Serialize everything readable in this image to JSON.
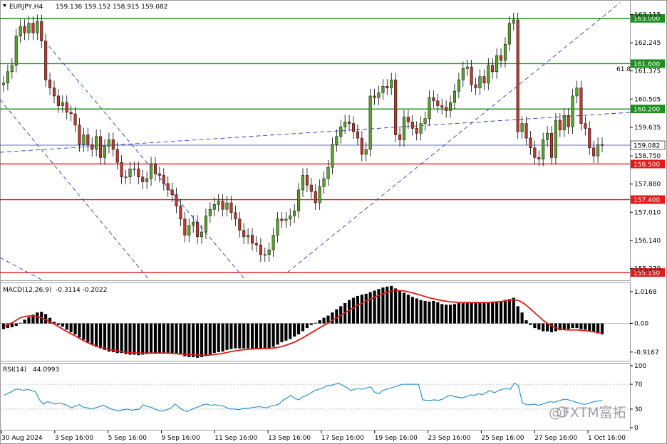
{
  "header": {
    "symbol": "EURJPY,H4",
    "ohlc": "159.136 159.152 158.915 159.082"
  },
  "watermark": "@FXTM富拓",
  "colors": {
    "bull": "#5aa32b",
    "bear": "#c0392b",
    "wick": "#000000",
    "support_line": "#e21b1b",
    "resistance_line": "#1e8f1e",
    "price_line": "#3a3ab5",
    "trend_line": "#2b3cc2",
    "macd_signal": "#e21b1b",
    "rsi": "#2a93d4",
    "grid": "#9a9a9a"
  },
  "chart_data": [
    {
      "type": "candlestick",
      "panel": "price",
      "title": "EURJPY,H4",
      "ylim": [
        154.95,
        163.5
      ],
      "y_ticks": [
        "163.115",
        "162.245",
        "161.375",
        "160.505",
        "159.635",
        "158.750",
        "157.880",
        "157.010",
        "156.140",
        "155.270"
      ],
      "x_ticks": [
        "30 Aug 2024",
        "3 Sep 16:00",
        "5 Sep 16:00",
        "9 Sep 16:00",
        "11 Sep 16:00",
        "13 Sep 16:00",
        "17 Sep 16:00",
        "19 Sep 16:00",
        "23 Sep 16:00",
        "25 Sep 16:00",
        "27 Sep 16:00",
        "1 Oct 16:00"
      ],
      "horizontal_levels": [
        {
          "value": 163.0,
          "label": "163.000",
          "kind": "resistance"
        },
        {
          "value": 161.6,
          "label": "161.600",
          "kind": "resistance"
        },
        {
          "value": 160.2,
          "label": "160.200",
          "kind": "resistance"
        },
        {
          "value": 158.5,
          "label": "158.500",
          "kind": "support"
        },
        {
          "value": 157.4,
          "label": "157.400",
          "kind": "support"
        },
        {
          "value": 155.15,
          "label": "155.150",
          "kind": "support"
        }
      ],
      "current_price": {
        "value": 159.082,
        "label": "159.082"
      },
      "fib_label": "61.8",
      "close": [
        161.0,
        161.35,
        161.55,
        162.45,
        162.75,
        162.55,
        162.85,
        162.55,
        162.9,
        162.3,
        161.1,
        160.85,
        160.6,
        160.3,
        160.4,
        160.1,
        160.05,
        159.7,
        159.1,
        159.4,
        159.1,
        158.95,
        159.35,
        158.7,
        159.05,
        159.25,
        158.95,
        158.55,
        158.1,
        158.1,
        158.35,
        158.35,
        158.1,
        157.95,
        158.05,
        158.5,
        158.2,
        158.15,
        157.9,
        157.7,
        157.55,
        157.2,
        156.8,
        156.3,
        156.6,
        156.7,
        156.25,
        156.4,
        156.9,
        157.1,
        157.25,
        157.35,
        157.1,
        157.3,
        157.0,
        156.8,
        156.45,
        156.25,
        156.3,
        156.05,
        156.0,
        155.7,
        155.7,
        155.85,
        156.3,
        156.8,
        156.75,
        156.8,
        156.9,
        157.05,
        157.7,
        158.15,
        157.85,
        157.65,
        157.3,
        157.8,
        158.05,
        158.4,
        159.1,
        159.35,
        159.65,
        159.8,
        159.75,
        159.5,
        159.3,
        158.8,
        158.95,
        160.6,
        160.55,
        160.7,
        160.9,
        160.85,
        161.1,
        159.4,
        159.25,
        159.95,
        159.8,
        159.6,
        159.45,
        159.75,
        159.9,
        160.55,
        160.45,
        160.3,
        160.25,
        160.15,
        160.4,
        160.75,
        161.1,
        161.45,
        161.5,
        160.95,
        160.85,
        161.2,
        161.0,
        161.55,
        161.35,
        161.85,
        161.7,
        162.2,
        162.85,
        162.95,
        159.5,
        159.75,
        159.3,
        159.0,
        158.7,
        158.65,
        159.25,
        159.45,
        158.7,
        159.85,
        159.55,
        160.0,
        159.65,
        160.6,
        160.85,
        159.75,
        159.6,
        159.0,
        158.75,
        159.1,
        159.08
      ],
      "open_first": 160.95,
      "high_offset": 0.22,
      "low_offset": 0.22
    },
    {
      "type": "histogram+line",
      "panel": "macd",
      "title": "MACD(12,26,9)",
      "values_label": "-0.3114 -0.2022",
      "y_ticks": [
        "1.0168",
        "0.00",
        "-0.9167"
      ],
      "ylim": [
        -1.15,
        1.22
      ],
      "histogram": [
        -0.18,
        -0.15,
        -0.12,
        -0.08,
        0.02,
        0.12,
        0.2,
        0.28,
        0.35,
        0.37,
        0.3,
        0.18,
        0.05,
        -0.05,
        -0.1,
        -0.2,
        -0.28,
        -0.35,
        -0.45,
        -0.52,
        -0.6,
        -0.67,
        -0.75,
        -0.8,
        -0.85,
        -0.9,
        -0.92,
        -0.95,
        -0.95,
        -0.98,
        -1.0,
        -1.0,
        -1.02,
        -1.0,
        -0.98,
        -0.95,
        -0.97,
        -0.95,
        -0.95,
        -0.95,
        -0.97,
        -0.98,
        -1.0,
        -1.05,
        -1.08,
        -1.08,
        -1.1,
        -1.08,
        -1.05,
        -1.0,
        -0.95,
        -0.92,
        -0.9,
        -0.85,
        -0.82,
        -0.8,
        -0.8,
        -0.8,
        -0.8,
        -0.8,
        -0.8,
        -0.8,
        -0.82,
        -0.8,
        -0.75,
        -0.68,
        -0.6,
        -0.55,
        -0.5,
        -0.42,
        -0.35,
        -0.25,
        -0.15,
        -0.05,
        0.02,
        0.1,
        0.18,
        0.25,
        0.35,
        0.45,
        0.55,
        0.65,
        0.75,
        0.82,
        0.88,
        0.92,
        0.95,
        1.0,
        1.05,
        1.1,
        1.15,
        1.18,
        1.2,
        1.12,
        1.05,
        0.98,
        0.92,
        0.85,
        0.8,
        0.75,
        0.72,
        0.7,
        0.72,
        0.68,
        0.62,
        0.6,
        0.6,
        0.62,
        0.65,
        0.65,
        0.65,
        0.65,
        0.65,
        0.65,
        0.65,
        0.67,
        0.67,
        0.7,
        0.72,
        0.75,
        0.78,
        0.82,
        0.55,
        0.35,
        0.1,
        -0.05,
        -0.15,
        -0.2,
        -0.25,
        -0.25,
        -0.28,
        -0.25,
        -0.22,
        -0.2,
        -0.18,
        -0.15,
        -0.15,
        -0.18,
        -0.2,
        -0.25,
        -0.28,
        -0.32,
        -0.35
      ],
      "signal": [
        -0.1,
        -0.05,
        0.02,
        0.1,
        0.18,
        0.22,
        0.24,
        0.24,
        0.22,
        0.18,
        0.12,
        0.05,
        -0.02,
        -0.1,
        -0.18,
        -0.26,
        -0.33,
        -0.4,
        -0.48,
        -0.55,
        -0.62,
        -0.68,
        -0.73,
        -0.77,
        -0.8,
        -0.83,
        -0.86,
        -0.88,
        -0.9,
        -0.92,
        -0.93,
        -0.94,
        -0.95,
        -0.95,
        -0.95,
        -0.95,
        -0.95,
        -0.95,
        -0.95,
        -0.95,
        -0.96,
        -0.97,
        -0.98,
        -0.99,
        -1.0,
        -1.0,
        -1.01,
        -1.02,
        -1.02,
        -1.01,
        -1.0,
        -0.98,
        -0.96,
        -0.93,
        -0.9,
        -0.88,
        -0.86,
        -0.84,
        -0.83,
        -0.82,
        -0.81,
        -0.81,
        -0.8,
        -0.8,
        -0.79,
        -0.77,
        -0.74,
        -0.7,
        -0.65,
        -0.6,
        -0.53,
        -0.46,
        -0.38,
        -0.3,
        -0.22,
        -0.14,
        -0.06,
        0.02,
        0.1,
        0.18,
        0.26,
        0.34,
        0.42,
        0.5,
        0.58,
        0.65,
        0.72,
        0.78,
        0.84,
        0.9,
        0.95,
        1.0,
        1.03,
        1.05,
        1.05,
        1.04,
        1.01,
        0.98,
        0.94,
        0.9,
        0.86,
        0.82,
        0.79,
        0.76,
        0.73,
        0.71,
        0.69,
        0.68,
        0.67,
        0.67,
        0.67,
        0.67,
        0.67,
        0.67,
        0.67,
        0.67,
        0.68,
        0.69,
        0.7,
        0.72,
        0.74,
        0.76,
        0.74,
        0.68,
        0.58,
        0.46,
        0.34,
        0.22,
        0.1,
        0.0,
        -0.08,
        -0.14,
        -0.18,
        -0.2,
        -0.21,
        -0.21,
        -0.21,
        -0.22,
        -0.23,
        -0.25,
        -0.27,
        -0.29,
        -0.31
      ]
    },
    {
      "type": "line",
      "panel": "rsi",
      "title": "RSI(14)",
      "value_label": "44.0993",
      "y_ticks": [
        "100",
        "70",
        "30",
        "0"
      ],
      "ylim": [
        0,
        100
      ],
      "levels": [
        70,
        30
      ],
      "values": [
        52,
        55,
        58,
        62,
        62,
        60,
        62,
        60,
        58,
        45,
        38,
        42,
        40,
        38,
        40,
        38,
        36,
        32,
        35,
        37,
        33,
        32,
        30,
        32,
        34,
        36,
        33,
        30,
        28,
        27,
        29,
        30,
        28,
        29,
        30,
        37,
        34,
        33,
        30,
        27,
        27,
        29,
        32,
        38,
        33,
        28,
        26,
        29,
        32,
        34,
        37,
        38,
        36,
        37,
        36,
        35,
        32,
        30,
        30,
        29,
        31,
        31,
        32,
        33,
        34,
        33,
        32,
        35,
        36,
        38,
        44,
        48,
        52,
        47,
        45,
        50,
        52,
        56,
        60,
        62,
        64,
        68,
        68,
        70,
        72,
        68,
        65,
        60,
        62,
        63,
        62,
        64,
        66,
        57,
        55,
        60,
        62,
        64,
        66,
        68,
        70,
        70,
        70,
        70,
        70,
        45,
        44,
        44,
        45,
        44,
        46,
        50,
        52,
        50,
        49,
        48,
        50,
        53,
        52,
        55,
        53,
        57,
        60,
        56,
        60,
        62,
        63,
        62,
        72,
        68,
        40,
        37,
        37,
        38,
        36,
        38,
        40,
        42,
        41,
        43,
        45,
        46,
        44,
        42,
        40,
        38,
        38,
        40,
        42,
        43,
        44
      ],
      "watermark": "@FXTM富拓"
    }
  ]
}
